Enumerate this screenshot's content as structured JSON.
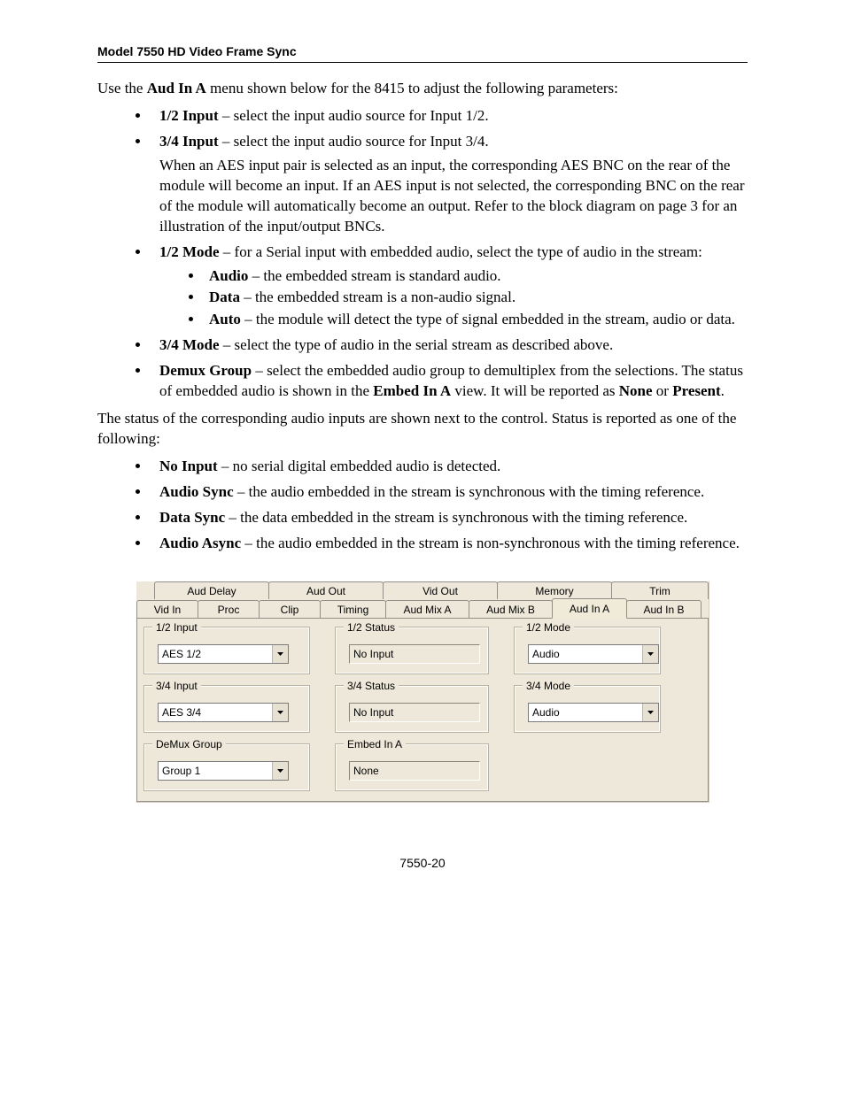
{
  "header": {
    "title": "Model 7550 HD Video Frame Sync"
  },
  "intro": {
    "lead_prefix": "Use the ",
    "lead_bold": "Aud In A",
    "lead_suffix": " menu shown below for the 8415 to adjust the following parameters:"
  },
  "params": {
    "input12_label": "1/2 Input",
    "input12_text": " – select the input audio source for Input 1/2.",
    "input34_label": "3/4 Input",
    "input34_text": " – select the input audio source for Input 3/4.",
    "input34_note": "When an AES input pair is selected as an input, the corresponding AES BNC on the rear of the module will become an input. If an AES input is not selected, the corresponding BNC on the rear of the module will automatically become an output. Refer to the block diagram on page 3 for an illustration of the input/output BNCs.",
    "mode12_label": "1/2 Mode",
    "mode12_text": " – for a Serial input with embedded audio, select the type of audio in the stream:",
    "mode12_audio_label": "Audio",
    "mode12_audio_text": " – the embedded stream is standard audio.",
    "mode12_data_label": "Data",
    "mode12_data_text": " – the embedded stream is a non-audio signal.",
    "mode12_auto_label": "Auto",
    "mode12_auto_text": " – the module will detect the type of signal embedded in the stream, audio or data.",
    "mode34_label": "3/4 Mode",
    "mode34_text": " – select the type of audio in the serial stream as described above.",
    "demux_label": "Demux Group",
    "demux_text_pre": " – select the embedded audio group to demultiplex from the selections. The status of embedded audio is shown in the ",
    "demux_text_bold": "Embed In A",
    "demux_text_mid": " view. It will be reported as ",
    "demux_text_none": "None",
    "demux_text_or": " or ",
    "demux_text_present": "Present",
    "demux_text_end": "."
  },
  "status_intro": "The status of the corresponding audio inputs are shown next to the control. Status is reported as one of the following:",
  "status": {
    "noinput_label": "No Input",
    "noinput_text": " – no serial digital embedded audio is detected.",
    "audiosync_label": "Audio Sync",
    "audiosync_text": " – the audio embedded in the stream is synchronous with the timing reference.",
    "datasync_label": "Data Sync",
    "datasync_text": " – the data embedded in the stream is synchronous with the timing reference.",
    "audioasync_label": "Audio Async",
    "audioasync_text": " – the audio embedded in the stream is non-synchronous with the timing reference."
  },
  "ui": {
    "tabs_upper": [
      "Aud Delay",
      "Aud Out",
      "Vid Out",
      "Memory",
      "Trim"
    ],
    "tabs_lower": [
      "Vid In",
      "Proc",
      "Clip",
      "Timing",
      "Aud Mix A",
      "Aud Mix B",
      "Aud In A",
      "Aud In B"
    ],
    "active_tab": "Aud In A",
    "group_12input_legend": "1/2 Input",
    "group_12input_value": "AES 1/2",
    "group_12status_legend": "1/2 Status",
    "group_12status_value": "No Input",
    "group_12mode_legend": "1/2 Mode",
    "group_12mode_value": "Audio",
    "group_34input_legend": "3/4 Input",
    "group_34input_value": "AES 3/4",
    "group_34status_legend": "3/4 Status",
    "group_34status_value": "No Input",
    "group_34mode_legend": "3/4 Mode",
    "group_34mode_value": "Audio",
    "group_demux_legend": "DeMux Group",
    "group_demux_value": "Group 1",
    "group_embed_legend": "Embed In A",
    "group_embed_value": "None"
  },
  "footer": "7550-20"
}
